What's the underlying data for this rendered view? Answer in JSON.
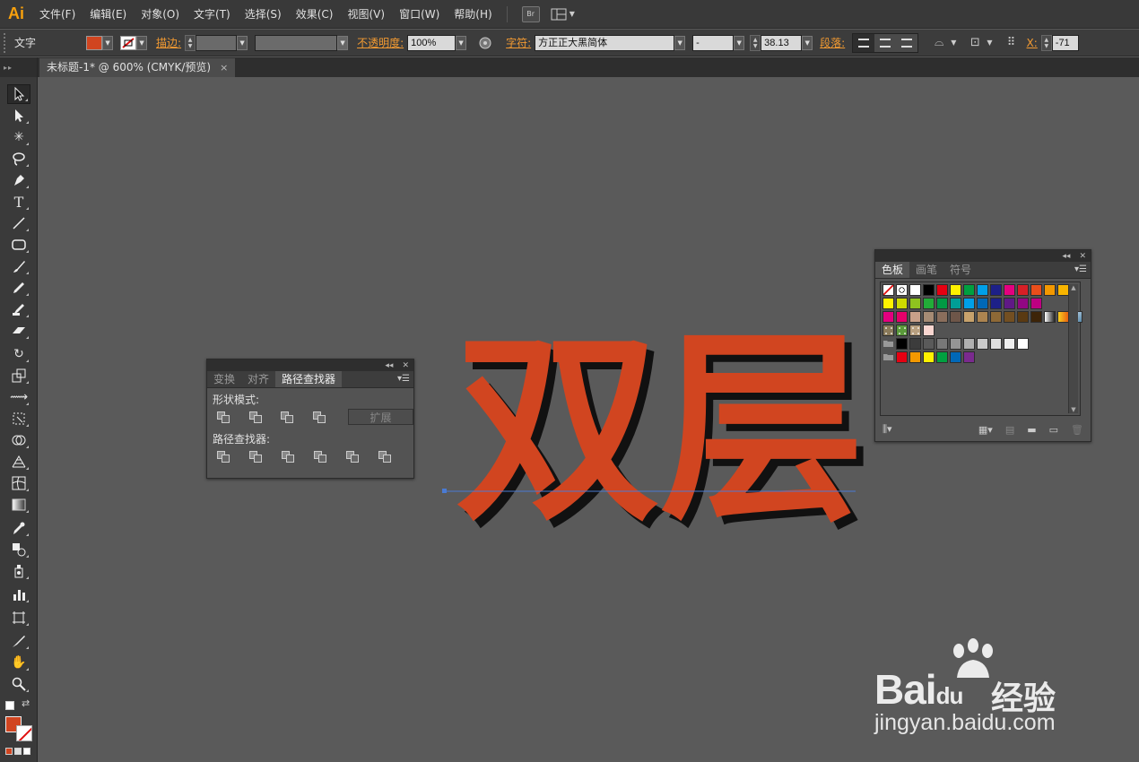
{
  "app": {
    "logo": "Ai",
    "menus": [
      "文件(F)",
      "编辑(E)",
      "对象(O)",
      "文字(T)",
      "选择(S)",
      "效果(C)",
      "视图(V)",
      "窗口(W)",
      "帮助(H)"
    ],
    "bridge_label": "Br"
  },
  "control_bar": {
    "tool_label": "文字",
    "fill_color": "#d14520",
    "stroke_label": "描边:",
    "opacity_label": "不透明度:",
    "opacity_value": "100%",
    "character_label": "字符:",
    "font_family": "方正正大黑简体",
    "font_style": "-",
    "font_size": "38.13",
    "paragraph_label": "段落:",
    "x_label": "X:",
    "x_value": "-71"
  },
  "document": {
    "tab_title": "未标题-1* @ 600% (CMYK/预览)",
    "close_glyph": "×"
  },
  "tools": [
    "selection-tool",
    "direct-selection-tool",
    "magic-wand-tool",
    "lasso-tool",
    "pen-tool",
    "type-tool",
    "line-segment-tool",
    "rectangle-tool",
    "paintbrush-tool",
    "pencil-tool",
    "blob-brush-tool",
    "eraser-tool",
    "rotate-tool",
    "scale-tool",
    "width-tool",
    "free-transform-tool",
    "shape-builder-tool",
    "perspective-grid-tool",
    "mesh-tool",
    "gradient-tool",
    "eyedropper-tool",
    "blend-tool",
    "symbol-sprayer-tool",
    "column-graph-tool",
    "artboard-tool",
    "slice-tool",
    "hand-tool",
    "zoom-tool"
  ],
  "artwork": {
    "text": "双层",
    "fill_color": "#d14520",
    "shadow_color": "#111111",
    "baseline_color": "#4a7bd4"
  },
  "pathfinder_panel": {
    "tabs": [
      "变换",
      "对齐",
      "路径查找器"
    ],
    "active_tab": "路径查找器",
    "shape_modes_label": "形状模式:",
    "expand_label": "扩展",
    "pathfinders_label": "路径查找器:"
  },
  "swatches_panel": {
    "tabs": [
      "色板",
      "画笔",
      "符号"
    ],
    "active_tab": "色板",
    "rows": [
      [
        "none",
        "registration",
        "#ffffff",
        "#000000",
        "#e60012",
        "#fff100",
        "#00a040",
        "#009fe8",
        "#1d2088",
        "#e4007f",
        "#d61f26",
        "#e94e1b",
        "#f39800",
        "#f8b500"
      ],
      [
        "#fff100",
        "#cfdb00",
        "#8fc31f",
        "#22ac38",
        "#009944",
        "#009e96",
        "#00a0e9",
        "#0068b7",
        "#1d2088",
        "#601986",
        "#920783",
        "#be0081"
      ],
      [
        "#e4007f",
        "#e5006a",
        "#c9a089",
        "#a68b74",
        "#8a6e5c",
        "#6e5649",
        "#c7a26c",
        "#ac8450",
        "#8e6936",
        "#734f22",
        "#5a3a12",
        "#3d2408",
        "gradient-bw",
        "gradient-orange",
        "gradient-blue"
      ],
      [
        "pattern-a",
        "pattern-b",
        "pattern-c",
        "#f9d6d0"
      ],
      [
        "folder",
        "#000000",
        "#3c3c3c",
        "#5a5a5a",
        "#787878",
        "#959595",
        "#b0b0b0",
        "#c9c9c9",
        "#dfdfdf",
        "#efefef",
        "#ffffff"
      ],
      [
        "folder",
        "#e60012",
        "#f39800",
        "#fff100",
        "#00a040",
        "#0068b7",
        "#7a2a8e"
      ]
    ]
  },
  "watermark": {
    "brand": "Bai",
    "brand_suffix": "du",
    "product": "经验",
    "url": "jingyan.baidu.com"
  }
}
